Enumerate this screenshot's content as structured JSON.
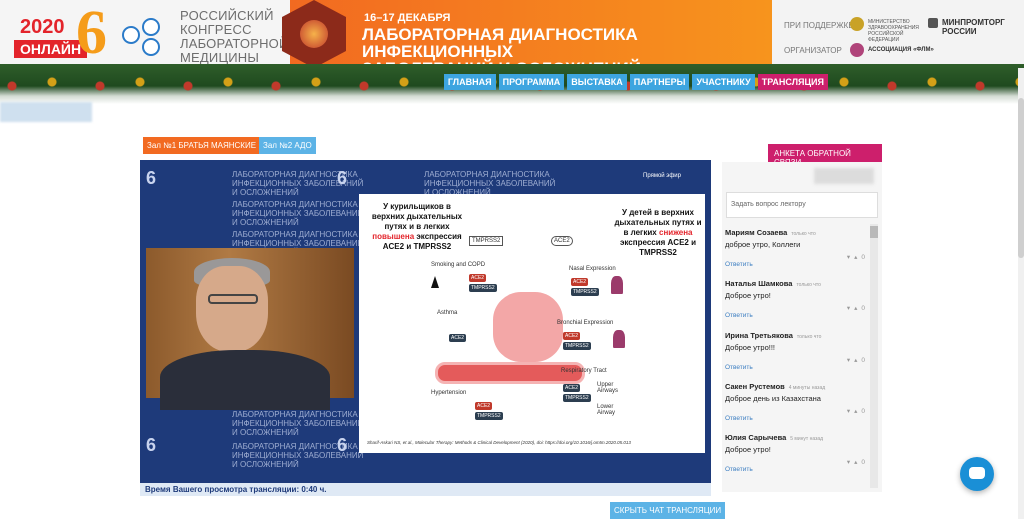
{
  "header": {
    "year": "2020",
    "online": "ОНЛАЙН",
    "edition_numeral": "6",
    "congress": [
      "РОССИЙСКИЙ",
      "КОНГРЕСС",
      "ЛАБОРАТОРНОЙ",
      "МЕДИЦИНЫ"
    ],
    "date": "16–17 ДЕКАБРЯ",
    "conference_title": [
      "ЛАБОРАТОРНАЯ ДИАГНОСТИКА ИНФЕКЦИОННЫХ",
      "ЗАБОЛЕВАНИЙ И ОСЛОЖНЕНИЙ"
    ],
    "support_label": "ПРИ ПОДДЕРЖКЕ",
    "organizer_label": "ОРГАНИЗАТОР",
    "ministry": "МИНИСТЕРСТВО ЗДРАВООХРАНЕНИЯ РОССИЙСКОЙ ФЕДЕРАЦИИ",
    "minprom": [
      "МИНПРОМТОРГ",
      "РОССИИ"
    ],
    "association": "АССОЦИАЦИЯ «ФЛМ»"
  },
  "nav": [
    {
      "label": "ГЛАВНАЯ",
      "active": false
    },
    {
      "label": "ПРОГРАММА",
      "active": false
    },
    {
      "label": "ВЫСТАВКА",
      "active": false
    },
    {
      "label": "ПАРТНЕРЫ",
      "active": false
    },
    {
      "label": "УЧАСТНИКУ",
      "active": false
    },
    {
      "label": "ТРАНСЛЯЦИЯ",
      "active": true
    }
  ],
  "halls": {
    "hall1": "Зал №1 БРАТЬЯ МАЯНСКИЕ",
    "hall2": "Зал №2 АДО"
  },
  "video": {
    "background_title": [
      "ЛАБОРАТОРНАЯ ДИАГНОСТИКА",
      "ИНФЕКЦИОННЫХ ЗАБОЛЕВАНИЙ",
      "И ОСЛОЖНЕНИЙ"
    ],
    "live_label": "Прямой эфир",
    "slide": {
      "left_text_1": "У курильщиков в верхних дыхательных путях и в легких",
      "left_highlight": "повышена",
      "left_text_2": "экспрессия ACE2 и TMPRSS2",
      "right_text_1": "У детей в верхних дыхательных путях и в легких",
      "right_highlight": "снижена",
      "right_text_2": "экспрессия ACE2 и TMPRSS2",
      "labels": {
        "tmprss2": "TMPRSS2",
        "ace2": "ACE2",
        "smoking": "Smoking and COPD",
        "asthma": "Asthma",
        "hypertension": "Hypertension",
        "nasal": "Nasal Expression",
        "bronchial": "Bronchial Expression",
        "resp": "Respiratory Tract",
        "upper": "Upper Airways",
        "lower": "Lower Airway"
      },
      "reference": "Sharif-Askari NS, et al., Molecular Therapy: Methods & Clinical Development (2020), doi: https://doi.org/10.1016/j.omtm.2020.05.013"
    }
  },
  "watch_time": {
    "label": "Время Вашего просмотра трансляции:",
    "value": "0:40 ч."
  },
  "hide_chat_label": "СКРЫТЬ ЧАТ ТРАНСЛЯЦИИ",
  "feedback_label": "АНКЕТА ОБРАТНОЙ СВЯЗИ",
  "chat": {
    "placeholder": "Задать вопрос лектору",
    "reply_label": "Ответить",
    "messages": [
      {
        "name": "Мариям Созаева",
        "time": "только что",
        "text": "доброе утро, Коллеги",
        "likes": "0"
      },
      {
        "name": "Наталья Шамкова",
        "time": "только что",
        "text": "Доброе утро!",
        "likes": "0"
      },
      {
        "name": "Ирина Третьякова",
        "time": "только что",
        "text": "Доброе утро!!!",
        "likes": "0"
      },
      {
        "name": "Сакен Рустемов",
        "time": "4 минуты назад",
        "text": "Доброе день из Казахстана",
        "likes": "0"
      },
      {
        "name": "Юлия Сарычева",
        "time": "5 минут назад",
        "text": "Доброе утро!",
        "likes": "0"
      }
    ]
  },
  "colors": {
    "accent_orange": "#f26a21",
    "accent_blue": "#3da5e0",
    "accent_magenta": "#cd1f6c",
    "video_bg": "#1e3a7a"
  },
  "icons": {
    "chat_fab": "chat-bubble-icon",
    "like": "thumb-up-icon",
    "dislike": "thumb-down-icon"
  }
}
